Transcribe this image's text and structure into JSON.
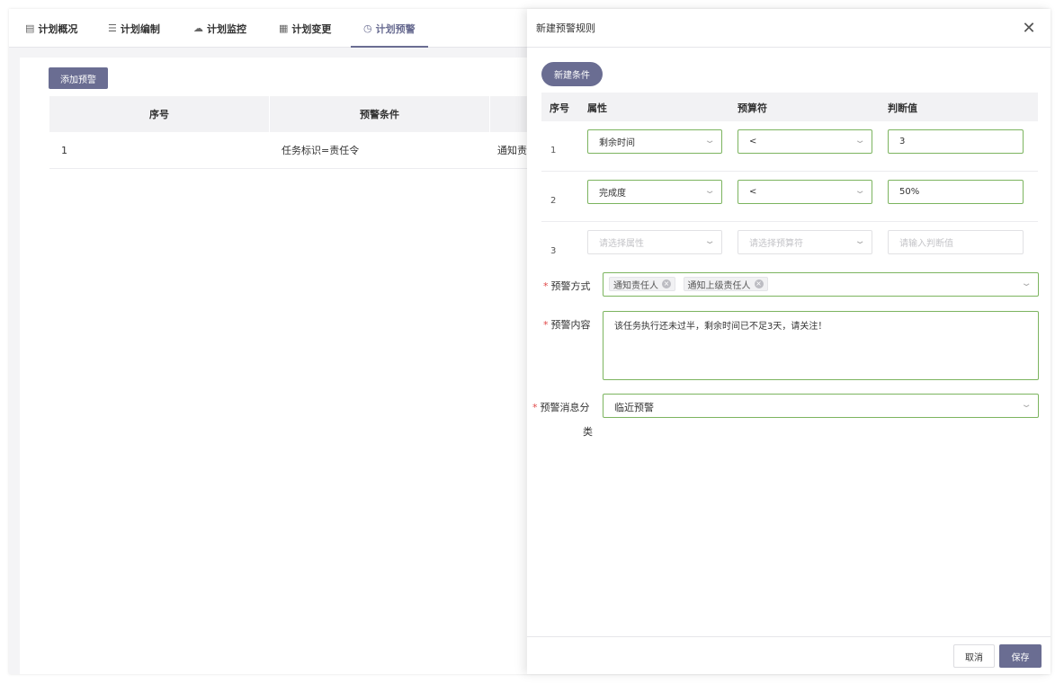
{
  "tabs": [
    {
      "icon": "document-icon",
      "glyph": "▤",
      "label": "计划概况"
    },
    {
      "icon": "list-icon",
      "glyph": "☰",
      "label": "计划编制"
    },
    {
      "icon": "cloud-icon",
      "glyph": "☁",
      "label": "计划监控"
    },
    {
      "icon": "file-change-icon",
      "glyph": "▦",
      "label": "计划变更"
    },
    {
      "icon": "clock-icon",
      "glyph": "◷",
      "label": "计划预警"
    }
  ],
  "active_tab": "计划预警",
  "background": {
    "add_button": "添加预警",
    "table": {
      "headers": [
        "序号",
        "预警条件"
      ],
      "rows": [
        {
          "index": "1",
          "condition": "任务标识=责任令",
          "action": "通知责"
        }
      ]
    }
  },
  "drawer": {
    "title": "新建预警规则",
    "close_glyph": "✕",
    "new_condition_button": "新建条件",
    "conditions": {
      "headers": {
        "index": "序号",
        "attribute": "属性",
        "operator": "预算符",
        "value": "判断值"
      },
      "rows": [
        {
          "index": "1",
          "attribute": "剩余时间",
          "operator": "<",
          "value": "3"
        },
        {
          "index": "2",
          "attribute": "完成度",
          "operator": "<",
          "value": "50%"
        },
        {
          "index": "3",
          "attribute_placeholder": "请选择属性",
          "operator_placeholder": "请选择预算符",
          "value_placeholder": "请输入判断值"
        }
      ]
    },
    "form": {
      "method_label": "预警方式",
      "method_tags": [
        "通知责任人",
        "通知上级责任人"
      ],
      "content_label": "预警内容",
      "content_value": "该任务执行还未过半，剩余时间已不足3天，请关注！",
      "category_label_line1": "预警消息分",
      "category_label_line2": "类",
      "category_value": "临近预警",
      "required_mark": "*"
    },
    "footer": {
      "cancel": "取消",
      "save": "保存"
    }
  },
  "colors": {
    "accent": "#6a6d92",
    "valid_border": "#7cb45f",
    "required": "#e04848"
  }
}
